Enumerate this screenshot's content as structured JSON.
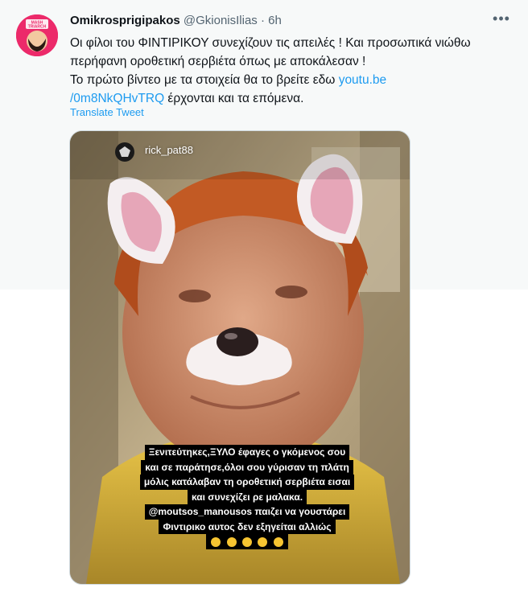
{
  "tweet": {
    "display_name": "Omikrosprigipakos",
    "handle": "@GkionisIlias",
    "separator": "·",
    "time": "6h",
    "more_label": "•••",
    "avatar_text": "MASH TRIARCH",
    "lines": [
      "Οι φίλοι του ΦΙΝΤΙΡΙΚΟΥ συνεχίζουν τις απειλές ! Και προσωπικά νιώθω",
      "περήφανη οροθετική σερβιέτα όπως με αποκάλεσαν !",
      "Το πρώτο βίντεο με τα στοιχεία θα το βρείτε εδω "
    ],
    "link_part1": "youtu.be",
    "link_part2": "/0m8NkQHvTRQ",
    "after_link": " έρχονται και τα επόμενα.",
    "translate_label": "Translate Tweet"
  },
  "media": {
    "story_username": "rick_pat88",
    "caption_lines": [
      "Ξενιτεύτηκες,ΞΥΛΟ έφαγες ο γκόμενος σου",
      "και σε παράτησε,όλοι σου γύρισαν τη πλάτη",
      "μόλις κατάλαβαν τη οροθετική σερβιέτα εισαι",
      "και συνεχίζει ρε μαλακα.",
      "@moutsos_manousos παιζει να γουστάρει",
      "Φιντιρικο αυτος δεν εξηγείται αλλιώς"
    ],
    "emoji_count": 5
  },
  "colors": {
    "accent": "#1d9bf0",
    "secondary_text": "#536471",
    "hover_background": "#f7f9f9"
  }
}
